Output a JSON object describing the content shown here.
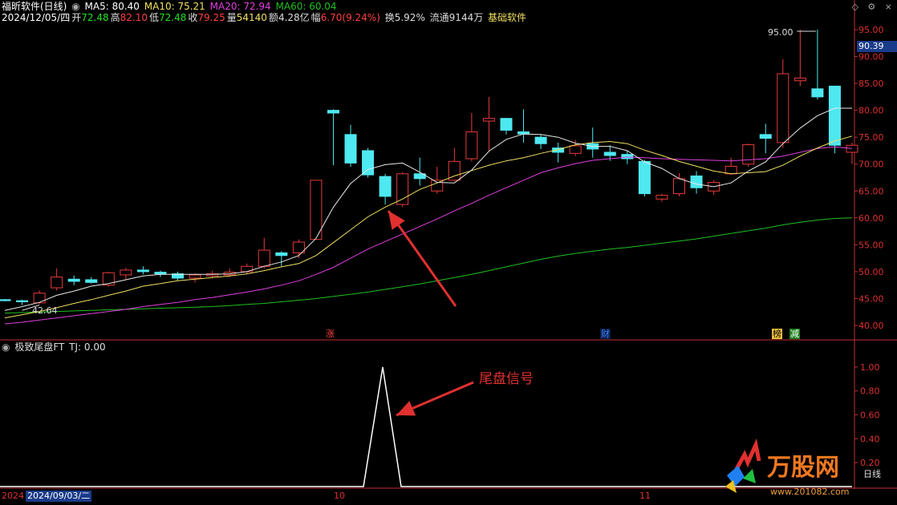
{
  "header": {
    "title": "福昕软件(日线)",
    "ma5": "MA5: 80.40",
    "ma10": "MA10: 75.21",
    "ma20": "MA20: 72.94",
    "ma60": "MA60: 60.04",
    "date": "2024/12/05/四",
    "open_label": "开",
    "open": "72.48",
    "high_label": "高",
    "high": "82.10",
    "low_label": "低",
    "low": "72.48",
    "close_label": "收",
    "close": "79.25",
    "vol_label": "量",
    "vol": "54140",
    "amt_label": "额",
    "amt": "4.28亿",
    "chg_label": "幅",
    "chg": "6.70(9.24%)",
    "turnover": "换5.92%",
    "float": "流通9144万",
    "link": "基础软件"
  },
  "indicator": {
    "title": "极致尾盘FT",
    "tj": "TJ: 0.00"
  },
  "axis": {
    "price_ticks": [
      "95.00",
      "90.00",
      "85.00",
      "80.00",
      "75.00",
      "70.00",
      "65.00",
      "60.00",
      "55.00",
      "50.00",
      "45.00",
      "40.00"
    ],
    "ind_ticks": [
      "1.00",
      "0.80",
      "0.60",
      "0.40",
      "0.20"
    ],
    "current_price": "90.39",
    "ind_unit": "日线"
  },
  "labels": {
    "high_mark": "95.00",
    "low_mark": "42.64",
    "tag_zhang": "涨",
    "tag_cai": "财",
    "tag_bang": "榜",
    "tag_jian": "减",
    "signal_text": "尾盘信号"
  },
  "datebar": {
    "year": "2024",
    "cursor_date": "2024/09/03/二",
    "m10": "10",
    "m11": "11"
  },
  "watermark": {
    "brand": "万股网",
    "site": "www.201082.com"
  },
  "colors": {
    "up": "#e83a3a",
    "down": "#4ee8f0",
    "ma5": "#e8e8e8",
    "ma10": "#f0e060",
    "ma20": "#e040e0",
    "ma60": "#20c020",
    "signal": "#ffffff",
    "axis_text": "#e03030"
  },
  "chart_data": {
    "type": "candlestick",
    "ylim": [
      40,
      95
    ],
    "candles": [
      {
        "o": 44.8,
        "c": 44.6,
        "h": 44.9,
        "l": 44.5
      },
      {
        "o": 44.6,
        "c": 44.4,
        "h": 44.8,
        "l": 43.8
      },
      {
        "o": 44.2,
        "c": 46.0,
        "h": 46.5,
        "l": 44.0
      },
      {
        "o": 47.0,
        "c": 49.0,
        "h": 50.6,
        "l": 46.5
      },
      {
        "o": 48.6,
        "c": 48.2,
        "h": 49.3,
        "l": 47.5
      },
      {
        "o": 48.5,
        "c": 48.0,
        "h": 49.0,
        "l": 47.8
      },
      {
        "o": 47.5,
        "c": 49.8,
        "h": 50.0,
        "l": 47.2
      },
      {
        "o": 49.4,
        "c": 50.3,
        "h": 50.7,
        "l": 48.5
      },
      {
        "o": 50.3,
        "c": 50.0,
        "h": 51.0,
        "l": 49.5
      },
      {
        "o": 49.9,
        "c": 49.6,
        "h": 50.2,
        "l": 49.0
      },
      {
        "o": 49.6,
        "c": 48.8,
        "h": 50.0,
        "l": 48.4
      },
      {
        "o": 48.8,
        "c": 49.4,
        "h": 49.7,
        "l": 48.0
      },
      {
        "o": 49.2,
        "c": 49.6,
        "h": 50.2,
        "l": 48.8
      },
      {
        "o": 49.4,
        "c": 49.9,
        "h": 50.6,
        "l": 49.0
      },
      {
        "o": 50.0,
        "c": 51.0,
        "h": 51.5,
        "l": 49.6
      },
      {
        "o": 51.0,
        "c": 54.0,
        "h": 56.3,
        "l": 50.6
      },
      {
        "o": 53.5,
        "c": 53.0,
        "h": 53.8,
        "l": 51.0
      },
      {
        "o": 53.5,
        "c": 55.5,
        "h": 56.0,
        "l": 52.5
      },
      {
        "o": 56.0,
        "c": 67.0,
        "h": 67.0,
        "l": 56.0
      },
      {
        "o": 80.0,
        "c": 79.5,
        "h": 80.2,
        "l": 69.8
      },
      {
        "o": 75.5,
        "c": 70.2,
        "h": 77.3,
        "l": 69.5
      },
      {
        "o": 72.5,
        "c": 68.0,
        "h": 73.0,
        "l": 67.5
      },
      {
        "o": 67.7,
        "c": 64.0,
        "h": 68.2,
        "l": 62.5
      },
      {
        "o": 62.5,
        "c": 68.2,
        "h": 68.5,
        "l": 62.0
      },
      {
        "o": 68.2,
        "c": 67.3,
        "h": 71.2,
        "l": 66.0
      },
      {
        "o": 65.0,
        "c": 67.0,
        "h": 69.5,
        "l": 64.5
      },
      {
        "o": 67.0,
        "c": 70.5,
        "h": 73.0,
        "l": 66.8
      },
      {
        "o": 71.0,
        "c": 76.0,
        "h": 79.5,
        "l": 70.5
      },
      {
        "o": 78.0,
        "c": 78.5,
        "h": 82.5,
        "l": 72.5
      },
      {
        "o": 78.5,
        "c": 76.3,
        "h": 78.6,
        "l": 75.5
      },
      {
        "o": 76.0,
        "c": 75.6,
        "h": 80.2,
        "l": 74.0
      },
      {
        "o": 75.0,
        "c": 73.8,
        "h": 75.5,
        "l": 72.8
      },
      {
        "o": 73.0,
        "c": 72.2,
        "h": 74.0,
        "l": 70.3
      },
      {
        "o": 72.0,
        "c": 73.4,
        "h": 74.5,
        "l": 71.5
      },
      {
        "o": 73.8,
        "c": 72.8,
        "h": 76.8,
        "l": 71.2
      },
      {
        "o": 72.2,
        "c": 71.6,
        "h": 73.5,
        "l": 70.6
      },
      {
        "o": 71.8,
        "c": 71.0,
        "h": 72.5,
        "l": 70.0
      },
      {
        "o": 70.5,
        "c": 64.5,
        "h": 70.8,
        "l": 64.0
      },
      {
        "o": 63.5,
        "c": 64.2,
        "h": 64.5,
        "l": 63.0
      },
      {
        "o": 64.5,
        "c": 67.3,
        "h": 68.3,
        "l": 64.0
      },
      {
        "o": 67.8,
        "c": 65.6,
        "h": 68.7,
        "l": 64.5
      },
      {
        "o": 65.0,
        "c": 66.6,
        "h": 67.0,
        "l": 64.3
      },
      {
        "o": 68.2,
        "c": 69.6,
        "h": 71.2,
        "l": 68.0
      },
      {
        "o": 70.0,
        "c": 73.6,
        "h": 73.8,
        "l": 69.5
      },
      {
        "o": 75.5,
        "c": 74.8,
        "h": 77.5,
        "l": 72.0
      },
      {
        "o": 74.0,
        "c": 86.8,
        "h": 89.5,
        "l": 73.0
      },
      {
        "o": 85.5,
        "c": 86.0,
        "h": 95.0,
        "l": 84.5
      },
      {
        "o": 84.0,
        "c": 82.5,
        "h": 95.0,
        "l": 82.0
      },
      {
        "o": 84.5,
        "c": 73.5,
        "h": 84.5,
        "l": 72.0
      },
      {
        "o": 72.2,
        "c": 73.5,
        "h": 74.0,
        "l": 70.0
      }
    ],
    "ma5": [
      42.8,
      43.5,
      44.3,
      45.6,
      46.4,
      47.3,
      47.8,
      48.5,
      49.2,
      49.5,
      49.5,
      49.5,
      49.5,
      49.6,
      50.0,
      51.0,
      51.8,
      53.0,
      56.2,
      62.0,
      66.4,
      69.0,
      69.9,
      70.2,
      68.5,
      66.6,
      66.5,
      68.9,
      72.4,
      74.6,
      75.6,
      75.5,
      75.0,
      73.9,
      73.3,
      73.3,
      72.5,
      70.4,
      69.2,
      67.3,
      66.3,
      65.8,
      66.5,
      68.7,
      70.4,
      73.8,
      76.7,
      79.0,
      80.4,
      80.4
    ],
    "ma10": [
      41.4,
      42.0,
      42.6,
      43.3,
      44.1,
      44.8,
      45.6,
      46.4,
      47.3,
      47.8,
      48.3,
      48.6,
      48.9,
      49.2,
      49.6,
      50.2,
      50.9,
      51.5,
      53.0,
      55.4,
      57.8,
      60.2,
      62.0,
      63.5,
      65.3,
      66.5,
      67.8,
      68.8,
      69.8,
      70.6,
      71.2,
      72.0,
      72.7,
      73.6,
      74.0,
      74.2,
      73.8,
      72.6,
      71.6,
      70.5,
      69.6,
      68.7,
      68.2,
      68.4,
      68.6,
      69.8,
      71.5,
      73.0,
      74.3,
      75.2
    ],
    "ma20": [
      40.3,
      40.6,
      41.0,
      41.4,
      41.8,
      42.2,
      42.6,
      43.0,
      43.5,
      43.9,
      44.3,
      44.8,
      45.2,
      45.7,
      46.2,
      46.8,
      47.5,
      48.3,
      49.5,
      50.8,
      52.5,
      54.2,
      55.6,
      57.0,
      58.4,
      59.8,
      61.3,
      62.7,
      64.2,
      65.6,
      67.0,
      68.4,
      69.3,
      70.1,
      70.7,
      71.0,
      71.3,
      71.2,
      71.0,
      70.9,
      70.8,
      70.7,
      70.6,
      70.8,
      71.0,
      71.5,
      72.2,
      72.9,
      73.2,
      72.9
    ],
    "ma60": [
      42.3,
      42.4,
      42.5,
      42.6,
      42.7,
      42.8,
      42.9,
      43.0,
      43.1,
      43.2,
      43.3,
      43.4,
      43.5,
      43.7,
      43.9,
      44.1,
      44.4,
      44.7,
      45.0,
      45.4,
      45.8,
      46.2,
      46.7,
      47.2,
      47.7,
      48.3,
      48.9,
      49.5,
      50.2,
      50.9,
      51.6,
      52.3,
      52.9,
      53.4,
      53.8,
      54.2,
      54.5,
      54.9,
      55.3,
      55.7,
      56.1,
      56.6,
      57.1,
      57.6,
      58.1,
      58.7,
      59.2,
      59.6,
      59.9,
      60.0
    ],
    "indicator": {
      "x_pos": [
        0,
        453,
        477,
        500,
        1062
      ],
      "values": [
        0,
        0,
        1,
        0,
        0
      ],
      "ylim": [
        0,
        1.08
      ]
    }
  }
}
